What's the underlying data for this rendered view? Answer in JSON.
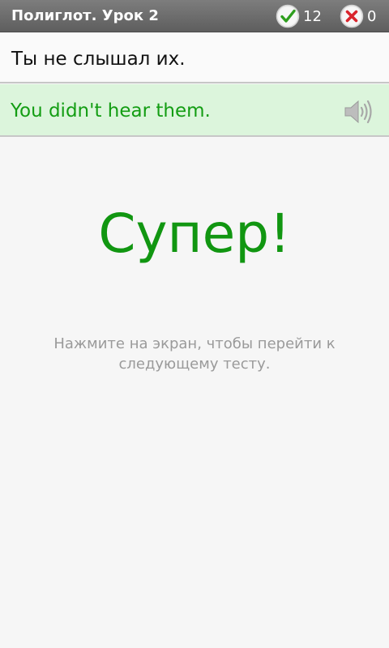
{
  "header": {
    "title": "Полиглот. Урок 2",
    "correct_count": "12",
    "wrong_count": "0",
    "correct_icon": "check-circle-icon",
    "wrong_icon": "x-circle-icon"
  },
  "exercise": {
    "source_text": "Ты не слышал их.",
    "answer_text": "You didn't hear them.",
    "speaker_icon": "speaker-icon"
  },
  "feedback": {
    "result": "Супер!",
    "hint": "Нажмите на экран, чтобы перейти к следующему тесту."
  },
  "colors": {
    "accent_green": "#119611",
    "answer_background": "#dcf5dc",
    "hint_gray": "#9a9a9a",
    "error_red": "#d9242c"
  }
}
